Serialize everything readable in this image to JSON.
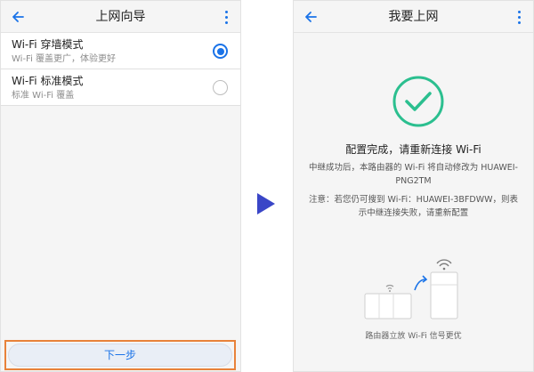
{
  "left_screen": {
    "title": "上网向导",
    "modes": [
      {
        "label": "Wi-Fi 穿墙模式",
        "description": "Wi-Fi 覆盖更广，体验更好",
        "selected": true
      },
      {
        "label": "Wi-Fi 标准模式",
        "description": "标准 Wi-Fi 覆盖",
        "selected": false
      }
    ],
    "next_button": "下一步"
  },
  "right_screen": {
    "title": "我要上网",
    "success_title": "配置完成，请重新连接 Wi-Fi",
    "success_message": "中继成功后，本路由器的 Wi-Fi 将自动修改为 HUAWEI-PNG2TM",
    "note": "注意：若您仍可搜到 Wi-Fi：HUAWEI-3BFDWW，则表示中继连接失败，请重新配置",
    "caption": "路由器立放 Wi-Fi 信号更优"
  },
  "colors": {
    "accent": "#1a73e8",
    "success": "#2bbf8f",
    "highlight": "#e8823a",
    "arrow": "#3a46c7"
  },
  "icons": [
    "back-arrow-icon",
    "more-vert-icon",
    "radio-icon",
    "checkmark-icon",
    "play-arrow-icon",
    "router-icon",
    "wifi-icon"
  ]
}
